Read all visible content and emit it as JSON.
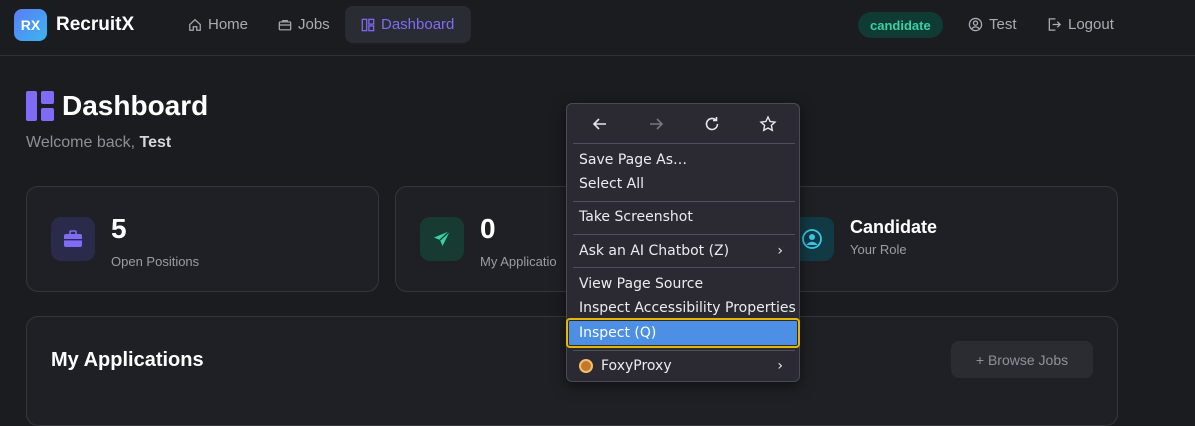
{
  "nav": {
    "logo": "RX",
    "brand": "RecruitX",
    "links": [
      {
        "label": "Home"
      },
      {
        "label": "Jobs"
      },
      {
        "label": "Dashboard"
      }
    ],
    "role_badge": "candidate",
    "user": "Test",
    "logout": "Logout",
    "colors": {
      "accent": "#7f6cf6",
      "badge": "#36d1a5"
    }
  },
  "main": {
    "title": "Dashboard",
    "welcome_prefix": "Welcome back, ",
    "welcome_name": "Test",
    "stats": [
      {
        "value": "5",
        "label": "Open Positions",
        "icon": "briefcase-icon"
      },
      {
        "value": "0",
        "label": "My Applicatio",
        "icon": "send-icon"
      },
      {
        "value": "Candidate",
        "label": "Your Role",
        "icon": "user-circle-icon"
      }
    ],
    "applications": {
      "title": "My Applications",
      "browse_label": "+ Browse Jobs"
    }
  },
  "context_menu": {
    "nav_icons": [
      "back-icon",
      "forward-icon",
      "reload-icon",
      "bookmark-icon"
    ],
    "items": [
      {
        "label": "Save Page As…"
      },
      {
        "label": "Select All"
      },
      {
        "label": "Take Screenshot"
      },
      {
        "label": "Ask an AI Chatbot (Z)",
        "submenu": "›"
      },
      {
        "label": "View Page Source"
      },
      {
        "label": "Inspect Accessibility Properties"
      },
      {
        "label": "Inspect (Q)"
      },
      {
        "label": "FoxyProxy",
        "submenu": "›"
      }
    ]
  }
}
